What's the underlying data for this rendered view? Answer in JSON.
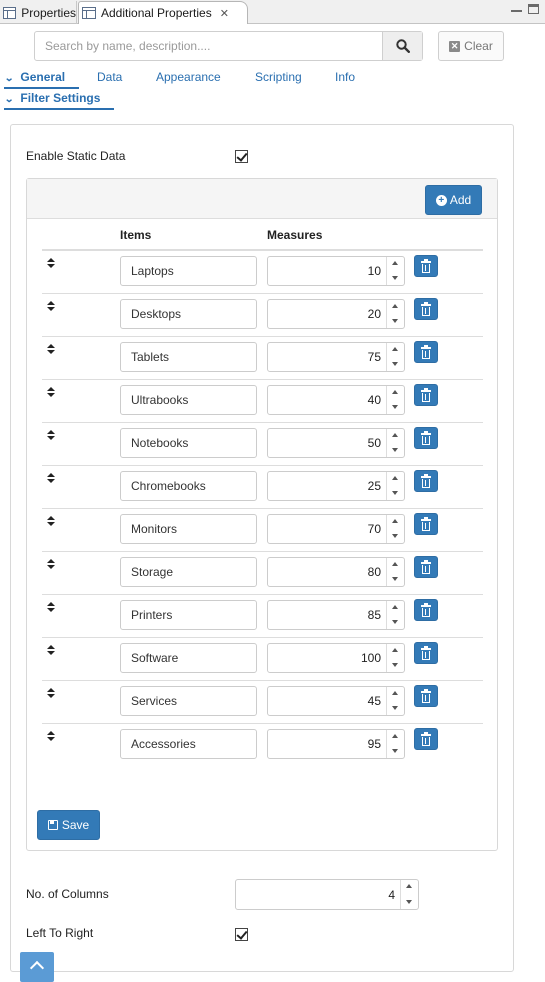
{
  "tabs": {
    "properties": "Properties",
    "additional": "Additional Properties",
    "close_glyph": "✕"
  },
  "search": {
    "placeholder": "Search by name, description....",
    "value": "",
    "clear_label": "Clear"
  },
  "nav": {
    "general": "General",
    "data": "Data",
    "appearance": "Appearance",
    "scripting": "Scripting",
    "info": "Info",
    "filter_settings": "Filter Settings"
  },
  "static_data": {
    "label": "Enable Static Data",
    "checked": true
  },
  "items_table": {
    "add_label": "Add",
    "col_items": "Items",
    "col_measures": "Measures",
    "rows": [
      {
        "item": "Laptops",
        "measure": "10"
      },
      {
        "item": "Desktops",
        "measure": "20"
      },
      {
        "item": "Tablets",
        "measure": "75"
      },
      {
        "item": "Ultrabooks",
        "measure": "40"
      },
      {
        "item": "Notebooks",
        "measure": "50"
      },
      {
        "item": "Chromebooks",
        "measure": "25"
      },
      {
        "item": "Monitors",
        "measure": "70"
      },
      {
        "item": "Storage",
        "measure": "80"
      },
      {
        "item": "Printers",
        "measure": "85"
      },
      {
        "item": "Software",
        "measure": "100"
      },
      {
        "item": "Services",
        "measure": "45"
      },
      {
        "item": "Accessories",
        "measure": "95"
      }
    ],
    "save_label": "Save"
  },
  "columns": {
    "label": "No. of Columns",
    "value": "4"
  },
  "ltr": {
    "label": "Left To Right",
    "checked": true
  },
  "colors": {
    "accent": "#2a6fb0",
    "button": "#337ab7"
  },
  "icons": {
    "search": "search-icon",
    "clear": "clear-x-icon",
    "add": "plus-circle-icon",
    "delete": "trash-icon",
    "drag": "sort-handle-icon",
    "save": "floppy-icon",
    "scroll_top": "chevron-up-icon"
  }
}
